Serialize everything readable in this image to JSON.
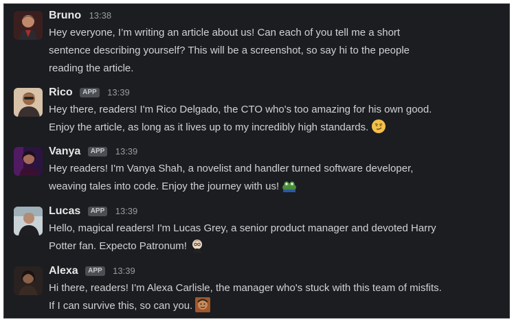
{
  "messages": [
    {
      "name": "Bruno",
      "badge": "",
      "time": "13:38",
      "line1": "Hey everyone, I’m writing an article about us! Can each of you tell me a short",
      "line2": "sentence describing yourself? This will be a screenshot, so say hi to the people",
      "line3": "reading the article.",
      "avatar_color": "#7a2b2b"
    },
    {
      "name": "Rico",
      "badge": "APP",
      "time": "13:39",
      "line1": "Hey there, readers! I'm Rico Delgado, the CTO who's too amazing for his own good.",
      "line2": "Enjoy the article, as long as it lives up to my incredibly high standards.",
      "emoji": "smirk-emoji",
      "avatar_color": "#c9a07a"
    },
    {
      "name": "Vanya",
      "badge": "APP",
      "time": "13:39",
      "line1": "Hey readers! I'm Vanya Shah, a novelist and handler turned software developer,",
      "line2": "weaving tales into code. Enjoy the journey with us!",
      "emoji": "frog-emoji",
      "avatar_color": "#5a2a6a"
    },
    {
      "name": "Lucas",
      "badge": "APP",
      "time": "13:39",
      "line1": "Hello, magical readers! I'm Lucas Grey, a senior product manager and devoted Harry",
      "line2": "Potter fan. Expecto Patronum!",
      "emoji": "wizard-emoji",
      "avatar_color": "#2f3a40"
    },
    {
      "name": "Alexa",
      "badge": "APP",
      "time": "13:39",
      "line1": "Hi there, readers! I'm Alexa Carlisle, the manager who's stuck with this team of misfits.",
      "line2": "If I can survive this, so can you.",
      "emoji": "face-emoji",
      "avatar_color": "#3a2a22"
    }
  ]
}
